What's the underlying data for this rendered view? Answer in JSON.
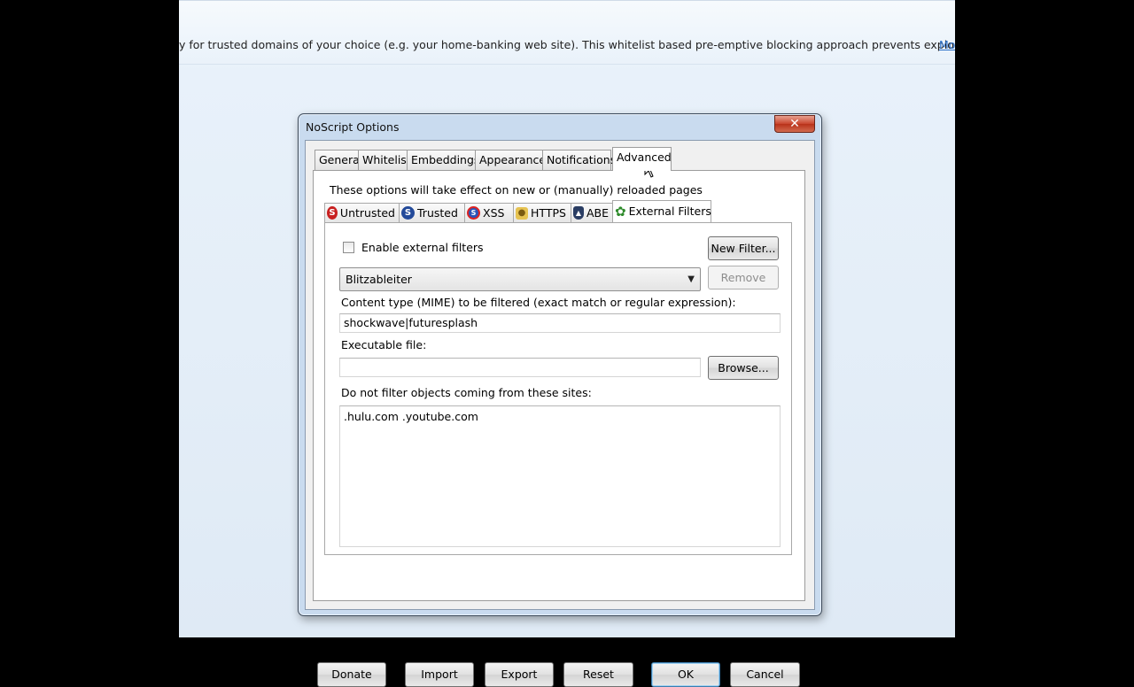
{
  "background_page": {
    "intro_text": "y for trusted domains of your choice (e.g. your home-banking web site). This whitelist based pre-emptive blocking approach  prevents exploitation of s...",
    "more_link": "Mo"
  },
  "dialog": {
    "title": "NoScript Options",
    "close_glyph": "✕",
    "tabs": [
      "General",
      "Whitelist",
      "Embeddings",
      "Appearance",
      "Notifications",
      "Advanced"
    ],
    "active_tab": "Advanced",
    "advanced_note": "These options will take effect on new or (manually) reloaded pages",
    "subtabs": [
      "Untrusted",
      "Trusted",
      "XSS",
      "HTTPS",
      "ABE",
      "External Filters"
    ],
    "active_subtab": "External Filters",
    "external_filters": {
      "enable_label": "Enable external filters",
      "enable_checked": false,
      "new_filter_button": "New Filter...",
      "filter_selected": "Blitzableiter",
      "remove_button": "Remove",
      "content_type_label": "Content type (MIME) to be filtered (exact match or regular expression):",
      "content_type_value": "shockwave|futuresplash",
      "executable_label": "Executable file:",
      "executable_value": "",
      "browse_button": "Browse...",
      "exclude_sites_label": "Do not filter objects coming from these sites:",
      "exclude_sites_value": ".hulu.com .youtube.com"
    },
    "footer": {
      "donate": "Donate",
      "import": "Import",
      "export": "Export",
      "reset": "Reset",
      "ok": "OK",
      "cancel": "Cancel"
    }
  }
}
